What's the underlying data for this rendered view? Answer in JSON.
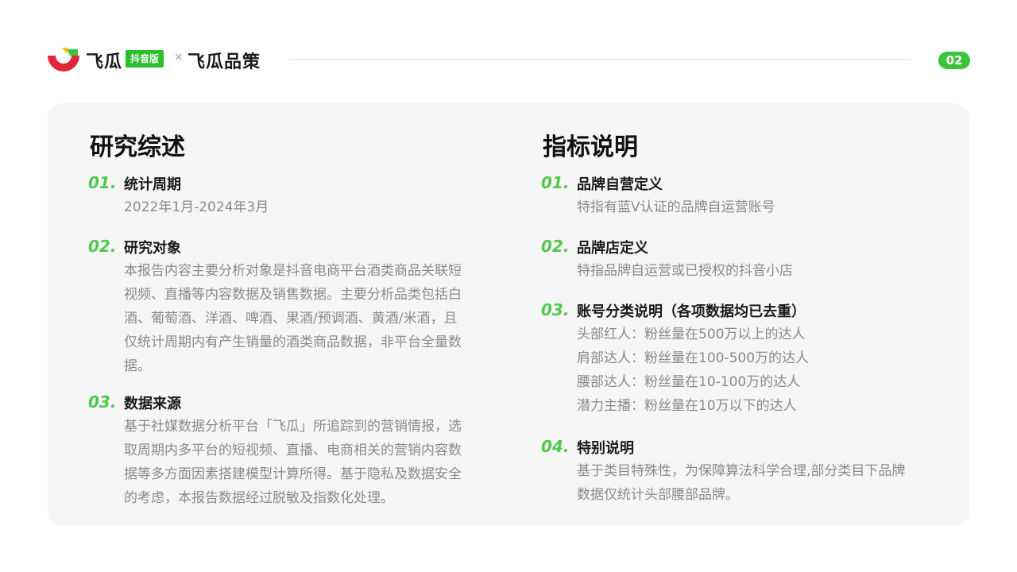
{
  "header": {
    "brand1": "飞瓜",
    "badge": "抖音版",
    "cross": "×",
    "brand2": "飞瓜品策",
    "page_number": "02"
  },
  "left": {
    "title": "研究综述",
    "sections": [
      {
        "num": "01.",
        "title": "统计周期",
        "lines": [
          "2022年1月-2024年3月"
        ]
      },
      {
        "num": "02.",
        "title": "研究对象",
        "lines": [
          "本报告内容主要分析对象是抖音电商平台酒类商品关联短",
          "视频、直播等内容数据及销售数据。主要分析品类包括白",
          "酒、葡萄酒、洋酒、啤酒、果酒/预调酒、黄酒/米酒，且",
          "仅统计周期内有产生销量的酒类商品数据，非平台全量数",
          "据。"
        ]
      },
      {
        "num": "03.",
        "title": "数据来源",
        "lines": [
          "基于社媒数据分析平台「飞瓜」所追踪到的营销情报，选",
          "取周期内多平台的短视频、直播、电商相关的营销内容数",
          "据等多方面因素搭建模型计算所得。基于隐私及数据安全",
          "的考虑，本报告数据经过脱敏及指数化处理。"
        ]
      }
    ]
  },
  "right": {
    "title": "指标说明",
    "sections": [
      {
        "num": "01.",
        "title": "品牌自营定义",
        "lines": [
          "特指有蓝V认证的品牌自运营账号"
        ]
      },
      {
        "num": "02.",
        "title": "品牌店定义",
        "lines": [
          "特指品牌自运营或已授权的抖音小店"
        ]
      },
      {
        "num": "03.",
        "title": "账号分类说明（各项数据均已去重）",
        "lines": [
          "头部红人：粉丝量在500万以上的达人",
          "肩部达人：粉丝量在100-500万的达人",
          "腰部达人：粉丝量在10-100万的达人",
          "潜力主播：粉丝量在10万以下的达人"
        ]
      },
      {
        "num": "04.",
        "title": "特别说明",
        "lines": [
          "基于类目特殊性，为保障算法科学合理,部分类目下品牌",
          "数据仅统计头部腰部品牌。"
        ]
      }
    ]
  },
  "colors": {
    "accent_green": "#4fc94d",
    "badge_green": "#2bbf2b",
    "logo_red": "#e0263a",
    "card_bg": "#f6f6f6"
  }
}
